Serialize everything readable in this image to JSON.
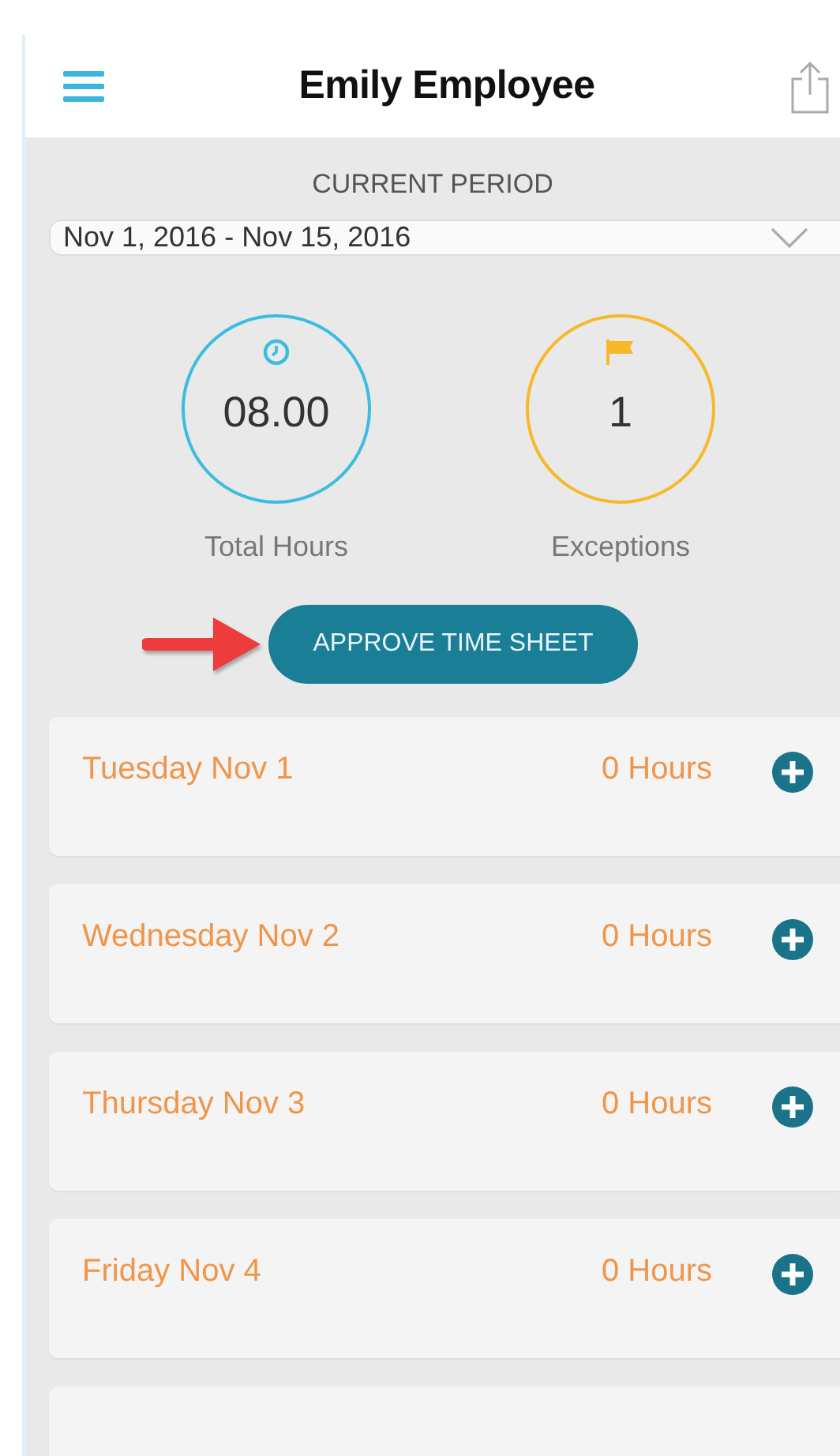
{
  "header": {
    "title": "Emily Employee"
  },
  "period": {
    "label": "CURRENT PERIOD",
    "value": "Nov 1, 2016 - Nov 15, 2016"
  },
  "stats": [
    {
      "kind": "hours",
      "value": "08.00",
      "label": "Total Hours",
      "color": "#3bbde0"
    },
    {
      "kind": "exceptions",
      "value": "1",
      "label": "Exceptions",
      "color": "#f7b82a"
    }
  ],
  "annotation": {
    "kind": "arrow"
  },
  "approve_button": "APPROVE TIME SHEET",
  "days": [
    {
      "date": "Tuesday Nov 1",
      "hours": "0 Hours"
    },
    {
      "date": "Wednesday Nov 2",
      "hours": "0 Hours"
    },
    {
      "date": "Thursday Nov 3",
      "hours": "0 Hours"
    },
    {
      "date": "Friday Nov 4",
      "hours": "0 Hours"
    }
  ]
}
